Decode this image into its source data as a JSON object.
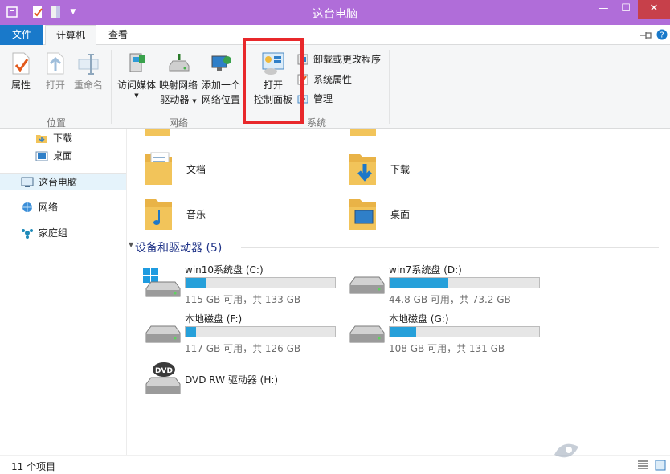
{
  "window": {
    "title": "这台电脑",
    "minimize_glyph": "—",
    "maximize_glyph": "☐",
    "close_glyph": "✕"
  },
  "ribbon_tabs": [
    {
      "label": "文件"
    },
    {
      "label": "计算机"
    },
    {
      "label": "查看"
    }
  ],
  "ribbon": {
    "location_group": {
      "label": "位置",
      "properties": "属性",
      "open": "打开",
      "rename": "重命名"
    },
    "network_group": {
      "label": "网络",
      "access_media": "访问媒体",
      "map_drive_line1": "映射网络",
      "map_drive_line2": "驱动器",
      "add_location_line1": "添加一个",
      "add_location_line2": "网络位置"
    },
    "system_group": {
      "label": "系统",
      "open_cp_line1": "打开",
      "open_cp_line2": "控制面板",
      "uninstall": "卸载或更改程序",
      "system_properties": "系统属性",
      "manage": "管理"
    }
  },
  "nav": {
    "downloads": "下载",
    "desktop": "桌面",
    "this_pc": "这台电脑",
    "network": "网络",
    "homegroup": "家庭组"
  },
  "folders": [
    {
      "label": "文档"
    },
    {
      "label": "下载"
    },
    {
      "label": "音乐"
    },
    {
      "label": "桌面"
    }
  ],
  "devices_section": {
    "title": "设备和驱动器 (5)"
  },
  "drives": [
    {
      "name": "win10系统盘 (C:)",
      "info": "115 GB 可用，共 133 GB",
      "used_fraction": 0.135
    },
    {
      "name": "win7系统盘 (D:)",
      "info": "44.8 GB 可用，共 73.2 GB",
      "used_fraction": 0.39
    },
    {
      "name": "本地磁盘 (F:)",
      "info": "117 GB 可用，共 126 GB",
      "used_fraction": 0.07
    },
    {
      "name": "本地磁盘 (G:)",
      "info": "108 GB 可用，共 131 GB",
      "used_fraction": 0.175
    },
    {
      "name": "DVD RW 驱动器 (H:)"
    }
  ],
  "status": {
    "count": "11 个项目"
  },
  "colors": {
    "titlebar": "#b06dd9",
    "file_tab": "#1979ca",
    "drive_bar": "#26a0da",
    "highlight": "#e8282b"
  }
}
